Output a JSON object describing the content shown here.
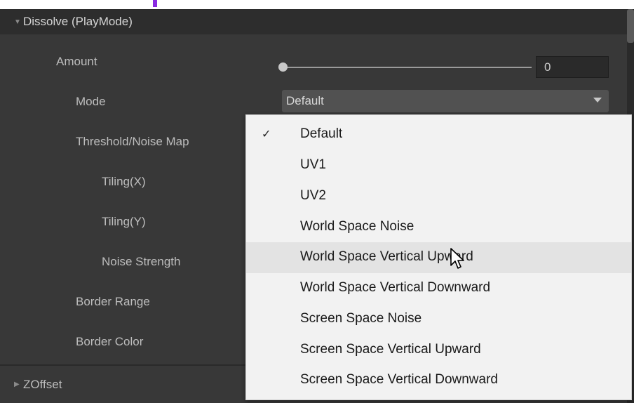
{
  "header": {
    "title": "Dissolve (PlayMode)"
  },
  "properties": {
    "amount_label": "Amount",
    "amount_value": "0",
    "mode_label": "Mode",
    "mode_value": "Default",
    "threshold_label": "Threshold/Noise Map",
    "tiling_x_label": "Tiling(X)",
    "tiling_y_label": "Tiling(Y)",
    "noise_strength_label": "Noise Strength",
    "border_range_label": "Border Range",
    "border_color_label": "Border Color"
  },
  "next_section": {
    "title": "ZOffset"
  },
  "menu": {
    "check_glyph": "✓",
    "items": [
      "Default",
      "UV1",
      "UV2",
      "World Space Noise",
      "World Space Vertical Upward",
      "World Space Vertical Downward",
      "Screen Space Noise",
      "Screen Space Vertical Upward",
      "Screen Space Vertical Downward"
    ]
  },
  "icons": {
    "expand": "triangle-down-icon",
    "collapse": "triangle-right-icon",
    "dropdown": "chevron-down-icon",
    "check": "checkmark-icon",
    "cursor": "mouse-pointer-icon"
  },
  "colors": {
    "panel_bg": "#383838",
    "header_bg": "#2d2d2d",
    "menu_bg": "#f2f2f2",
    "menu_hover": "#e3e3e3",
    "accent": "#8a2be2"
  }
}
